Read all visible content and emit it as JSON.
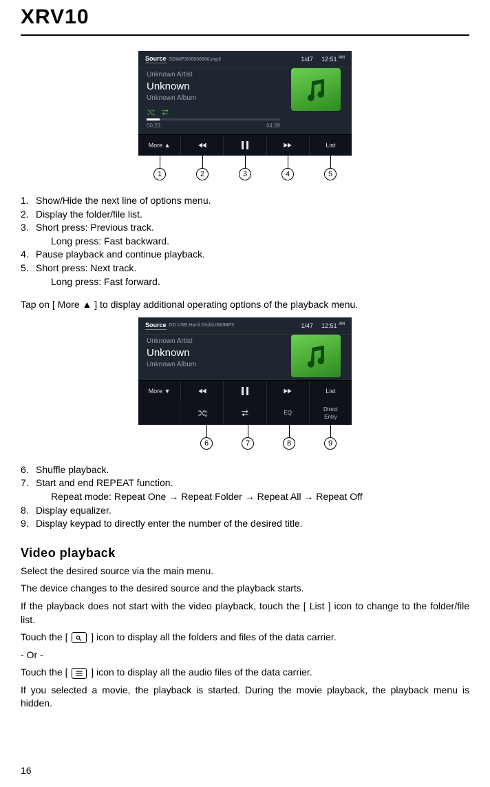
{
  "page": {
    "title": "XRV10",
    "number": "16"
  },
  "screenshot1": {
    "source_label": "Source",
    "path": "SD\\MP3\\00000000.mp3",
    "track_index": "1/47",
    "clock": "12:51",
    "clock_ampm": "AM",
    "artist": "Unknown Artist",
    "title": "Unknown",
    "album": "Unknown Album",
    "time_elapsed": "00:23",
    "time_total": "04:39",
    "controls": {
      "more": "More ▲",
      "list": "List"
    },
    "callouts": [
      "1",
      "2",
      "3",
      "4",
      "5"
    ]
  },
  "list1": {
    "i1": "Show/Hide the next line of options menu.",
    "i2": "Display the folder/file list.",
    "i3a": "Short press: Previous track.",
    "i3b": "Long press: Fast backward.",
    "i4": "Pause playback and continue playback.",
    "i5a": "Short press: Next track.",
    "i5b": "Long press: Fast forward."
  },
  "tap_line": "Tap on [ More ▲ ] to display additional operating options of the playback menu.",
  "screenshot2": {
    "source_label": "Source",
    "path": "DD USB Hard Disk\\USB\\MP3",
    "track_index": "1/47",
    "clock": "12:51",
    "clock_ampm": "AM",
    "artist": "Unknown Artist",
    "title": "Unknown",
    "album": "Unknown Album",
    "controls": {
      "more": "More ▼",
      "list": "List",
      "eq": "EQ",
      "de1": "Direct",
      "de2": "Entry"
    },
    "callouts": [
      "6",
      "7",
      "8",
      "9"
    ]
  },
  "list2": {
    "i6": "Shuffle playback.",
    "i7a": "Start and end REPEAT function.",
    "i7b": "Repeat mode: Repeat One → Repeat Folder → Repeat All → Repeat Off",
    "i8": "Display equalizer.",
    "i9": "Display keypad to directly enter the number of the desired title."
  },
  "video": {
    "heading": "Video playback",
    "p1": "Select the desired source via the main menu.",
    "p2": "The device changes to the desired source and the playback starts.",
    "p3": "If the playback does not start with the video playback, touch the [ List ] icon to change to the folder/file list.",
    "p4a": "Touch the [",
    "p4b": "] icon to display all the folders and files of the data carrier.",
    "p5": "- Or -",
    "p6a": "Touch the [",
    "p6b": "] icon to display all the audio files of the data carrier.",
    "p7": "If you selected a movie, the playback is started. During the movie playback, the playback menu is hidden."
  }
}
